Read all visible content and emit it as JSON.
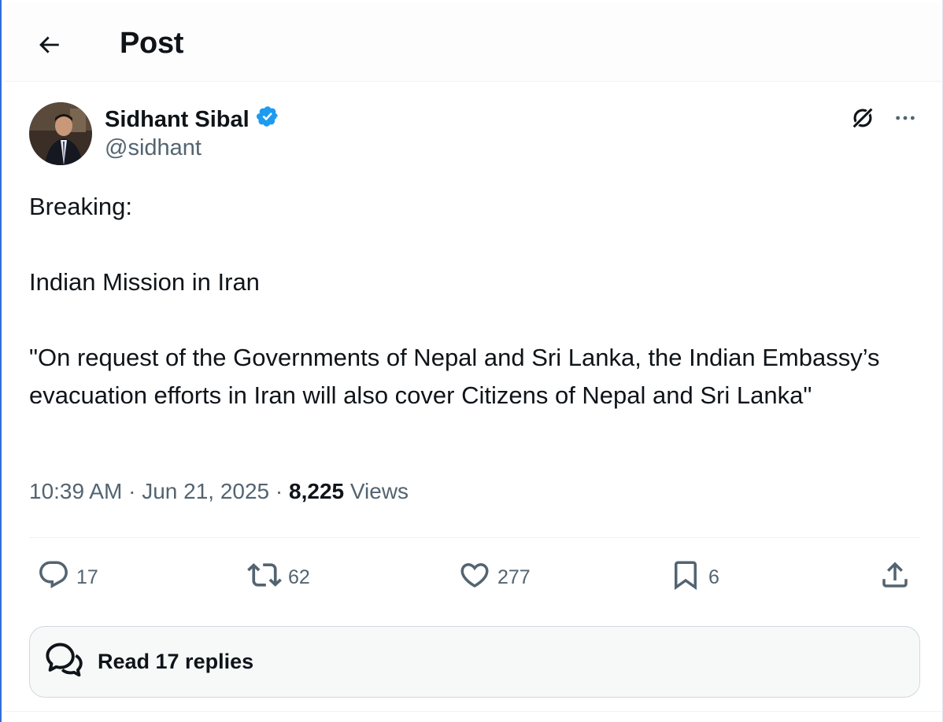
{
  "header": {
    "title": "Post",
    "back_icon": "arrow-left-icon"
  },
  "author": {
    "name": "Sidhant Sibal",
    "handle": "@sidhant",
    "verified_icon": "verified-badge-icon",
    "verified_color": "#1d9bf0"
  },
  "post": {
    "lines": [
      "Breaking:",
      "Indian Mission in Iran",
      "\"On request of the Governments of Nepal and Sri Lanka, the Indian Embassy’s evacuation efforts in Iran will also cover Citizens of Nepal and Sri Lanka\""
    ],
    "time": "10:39 AM",
    "date": "Jun 21, 2025",
    "views_count": "8,225",
    "views_label": "Views",
    "separator": "·"
  },
  "actions": {
    "replies": "17",
    "reposts": "62",
    "likes": "277",
    "bookmarks": "6"
  },
  "read_replies": {
    "label": "Read 17 replies",
    "icon": "chat-bubbles-icon"
  },
  "colors": {
    "text": "#0f1419",
    "secondary": "#536471",
    "accent": "#1d9bf0"
  }
}
